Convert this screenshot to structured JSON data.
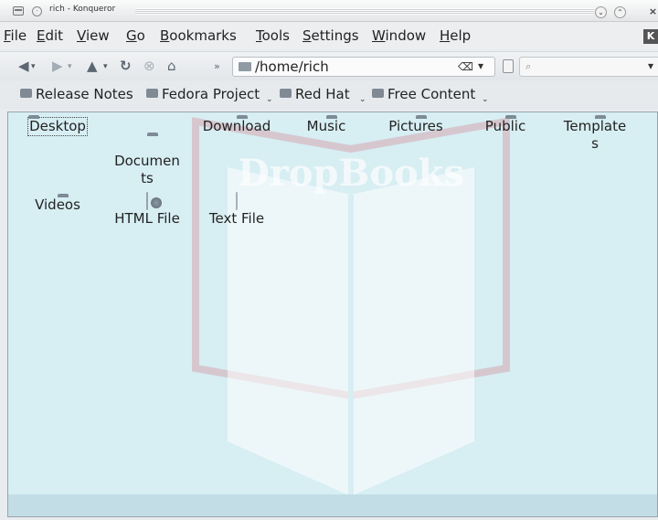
{
  "window": {
    "title": "rich - Konqueror"
  },
  "menubar": {
    "items": [
      "File",
      "Edit",
      "View",
      "Go",
      "Bookmarks",
      "Tools",
      "Settings",
      "Window",
      "Help"
    ],
    "underlines": [
      "F",
      "E",
      "V",
      "G",
      "B",
      "T",
      "S",
      "W",
      "H"
    ]
  },
  "location": {
    "url": "/home/rich",
    "search_placeholder": ""
  },
  "bookmarks": [
    "Release Notes",
    "Fedora Project",
    "Red Hat",
    "Free Content"
  ],
  "files": {
    "row1": [
      "Desktop",
      "Documents",
      "Download",
      "Music",
      "Pictures",
      "Public",
      "Templates"
    ],
    "row1_wrapped": [
      "Desktop",
      "Documen\nts",
      "Download",
      "Music",
      "Pictures",
      "Public",
      "Template\ns"
    ],
    "row2": [
      "Videos",
      "HTML File",
      "Text File"
    ],
    "selected": "Desktop"
  },
  "watermark": {
    "text": "DropBooks"
  },
  "colors": {
    "view_bg": "#d7eef3",
    "watermark": "#c9415a"
  }
}
